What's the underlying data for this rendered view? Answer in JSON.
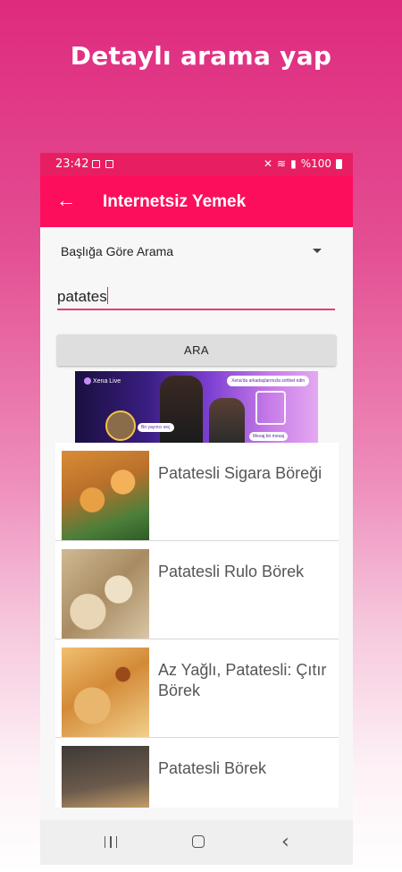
{
  "headline": "Detaylı arama yap",
  "status_bar": {
    "time": "23:42",
    "battery": "%100"
  },
  "app_bar": {
    "title": "Internetsiz Yemek"
  },
  "search": {
    "mode": "Başlığa Göre Arama",
    "query": "patates",
    "button_label": "ARA"
  },
  "ad": {
    "logo": "Xena Live",
    "bubble_top": "Xena'da arkadaşlarınızla sohbet edin",
    "bubble_left": "Bir yayıncı seç",
    "bubble_right": "Mesaj bir mesaj"
  },
  "results": [
    {
      "title": "Patatesli Sigara Böreği"
    },
    {
      "title": "Patatesli Rulo Börek"
    },
    {
      "title": "Az Yağlı, Patatesli: Çıtır Börek"
    },
    {
      "title": "Patatesli Börek"
    }
  ],
  "colors": {
    "accent": "#fd0e5c",
    "status_bar": "#e81e62"
  }
}
